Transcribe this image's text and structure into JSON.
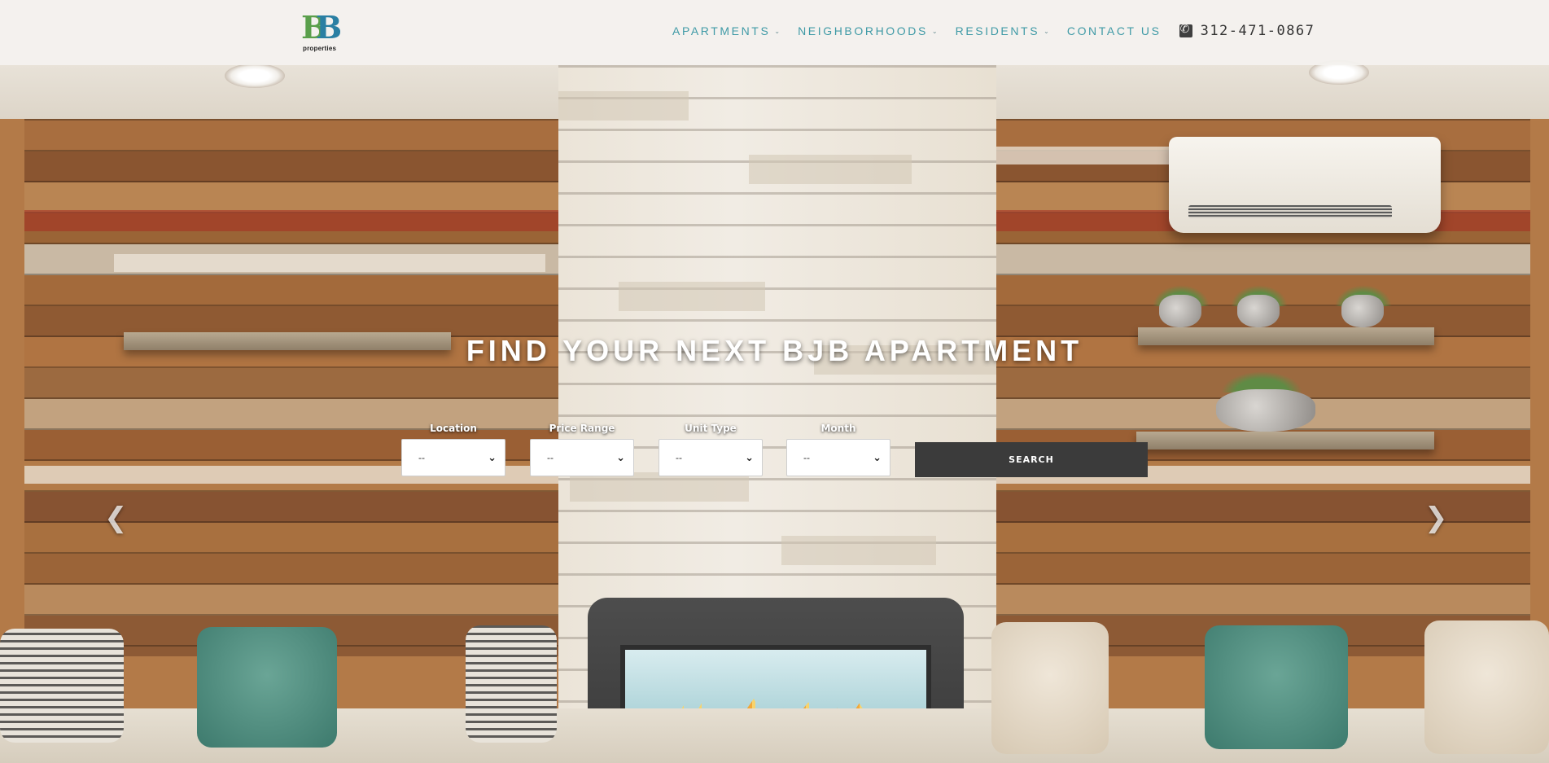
{
  "brand": {
    "logo_text": "properties",
    "logo_letters": [
      "B",
      "B"
    ],
    "colors": {
      "green": "#5a9f4b",
      "blue": "#2a7fa3",
      "nav_teal": "#3f9aa6",
      "button_dark": "#3b3b3b"
    }
  },
  "nav": {
    "items": [
      {
        "label": "APARTMENTS",
        "has_dropdown": true
      },
      {
        "label": "NEIGHBORHOODS",
        "has_dropdown": true
      },
      {
        "label": "RESIDENTS",
        "has_dropdown": true
      },
      {
        "label": "CONTACT US",
        "has_dropdown": false
      }
    ],
    "dropdown_icon": "chevron-down-icon",
    "phone_icon": "phone-icon",
    "phone": "312-471-0867"
  },
  "hero": {
    "headline": "FIND YOUR NEXT BJB APARTMENT",
    "prev_icon": "chevron-left-icon",
    "next_icon": "chevron-right-icon"
  },
  "search": {
    "fields": [
      {
        "label": "Location",
        "value": "--"
      },
      {
        "label": "Price Range",
        "value": "--"
      },
      {
        "label": "Unit Type",
        "value": "--"
      },
      {
        "label": "Month",
        "value": "--"
      }
    ],
    "button_label": "SEARCH"
  }
}
